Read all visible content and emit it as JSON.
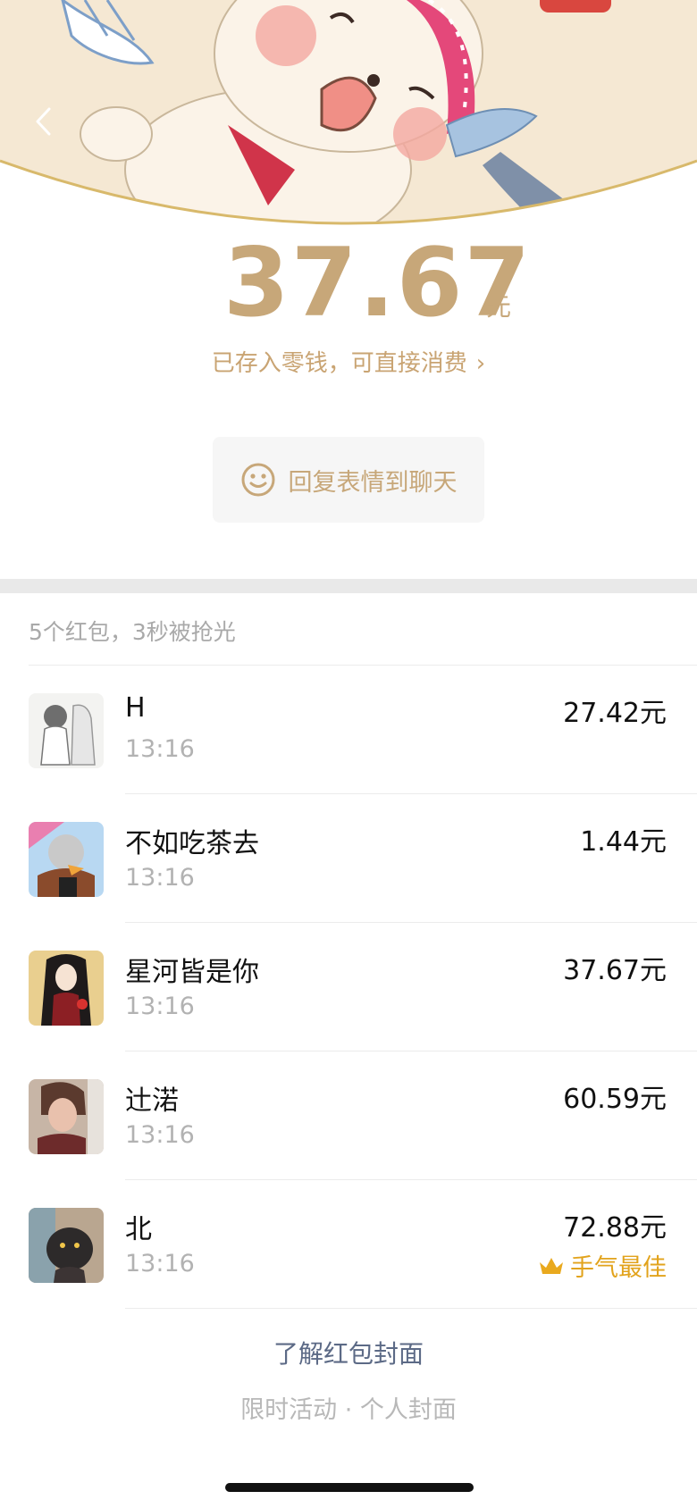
{
  "header": {
    "back_icon": "chevron-left-icon",
    "illustration": "cartoon-seal-cover"
  },
  "amount": {
    "value": "37.67",
    "unit": "元",
    "wallet_text": "已存入零钱，可直接消费",
    "wallet_chevron": "›"
  },
  "reply": {
    "icon": "smiley-icon",
    "label": "回复表情到聊天"
  },
  "summary": "5个红包，3秒被抢光",
  "recipients": [
    {
      "name": "H",
      "time": "13:16",
      "amount": "27.42元",
      "best": ""
    },
    {
      "name": "不如吃茶去",
      "time": "13:16",
      "amount": "1.44元",
      "best": ""
    },
    {
      "name": "星河皆是你",
      "time": "13:16",
      "amount": "37.67元",
      "best": ""
    },
    {
      "name": "辻渃",
      "time": "13:16",
      "amount": "60.59元",
      "best": ""
    },
    {
      "name": "北",
      "time": "13:16",
      "amount": "72.88元",
      "best": "手气最佳"
    }
  ],
  "footer": {
    "cover_link": "了解红包封面",
    "cover_sub": "限时活动 · 个人封面"
  },
  "colors": {
    "gold": "#c7a779",
    "best_gold": "#e2a31c",
    "link_blue": "#5c6a86"
  }
}
